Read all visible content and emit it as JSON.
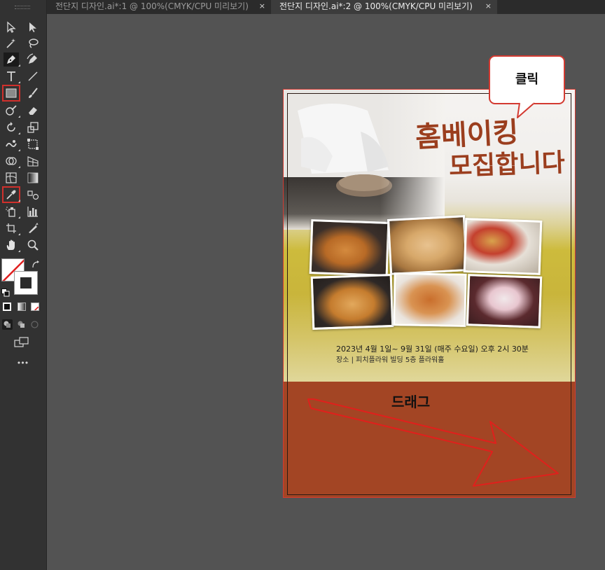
{
  "tabs": [
    {
      "label": "전단지 디자인.ai*:1 @ 100%(CMYK/CPU 미리보기)",
      "close": "×",
      "active": false
    },
    {
      "label": "전단지 디자인.ai*:2 @ 100%(CMYK/CPU 미리보기)",
      "close": "×",
      "active": true
    }
  ],
  "tools": [
    "selection-tool-icon",
    "direct-selection-tool-icon",
    "magic-wand-tool-icon",
    "lasso-tool-icon",
    "pen-tool-icon",
    "curvature-tool-icon",
    "type-tool-icon",
    "line-segment-tool-icon",
    "rectangle-tool-icon",
    "paintbrush-tool-icon",
    "shaper-tool-icon",
    "eraser-tool-icon",
    "rotate-tool-icon",
    "scale-tool-icon",
    "warp-tool-icon",
    "free-transform-tool-icon",
    "shape-builder-tool-icon",
    "perspective-grid-tool-icon",
    "mesh-tool-icon",
    "gradient-tool-icon",
    "eyedropper-tool-icon",
    "blend-tool-icon",
    "symbol-sprayer-tool-icon",
    "column-graph-tool-icon",
    "artboard-tool-icon",
    "slice-tool-icon",
    "hand-tool-icon",
    "zoom-tool-icon"
  ],
  "more_tools_label": "•••",
  "poster": {
    "title_line1": "홈베이킹",
    "title_line2": "모집합니다",
    "date_text": "2023년 4월 1일~ 9월 31일 (매주 수요일) 오후 2시 30분",
    "place_text": "장소 |  피치플라워 빌딩 5층 플라워홀"
  },
  "annotations": {
    "click_label": "클릭",
    "drag_label": "드래그"
  },
  "colors": {
    "highlight_red": "#d33a31",
    "title_brown": "#9b3e1e",
    "band_brown": "#a34524",
    "yellow": "#c9b53b"
  }
}
